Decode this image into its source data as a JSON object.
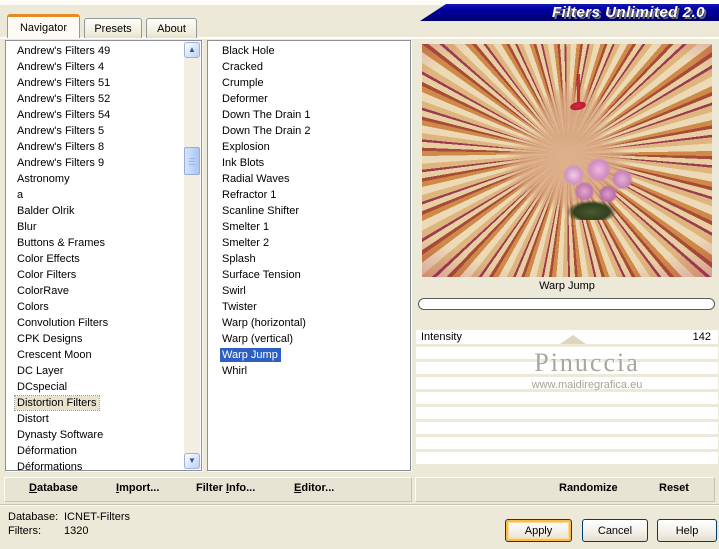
{
  "window": {
    "banner_title": "Filters Unlimited 2.0"
  },
  "tabs": [
    {
      "label": "Navigator",
      "active": true
    },
    {
      "label": "Presets",
      "active": false
    },
    {
      "label": "About",
      "active": false
    }
  ],
  "category_list": {
    "items": [
      "Andrew's Filters 49",
      "Andrew's Filters 4",
      "Andrew's Filters 51",
      "Andrew's Filters 52",
      "Andrew's Filters 54",
      "Andrew's Filters 5",
      "Andrew's Filters 8",
      "Andrew's Filters 9",
      "Astronomy",
      "a",
      "Balder Olrik",
      "Blur",
      "Buttons & Frames",
      "Color Effects",
      "Color Filters",
      "ColorRave",
      "Colors",
      "Convolution Filters",
      "CPK Designs",
      "Crescent Moon",
      "DC Layer",
      "DCspecial",
      "Distortion Filters",
      "Distort",
      "Dynasty Software",
      "Déformation",
      "Déformations"
    ],
    "selected": "Distortion Filters"
  },
  "filter_list": {
    "items": [
      "Black Hole",
      "Cracked",
      "Crumple",
      "Deformer",
      "Down The Drain 1",
      "Down The Drain 2",
      "Explosion",
      "Ink Blots",
      "Radial Waves",
      "Refractor 1",
      "Scanline Shifter",
      "Smelter 1",
      "Smelter 2",
      "Splash",
      "Surface Tension",
      "Swirl",
      "Twister",
      "Warp (horizontal)",
      "Warp (vertical)",
      "Warp Jump",
      "Whirl"
    ],
    "selected": "Warp Jump"
  },
  "preview": {
    "caption": "Warp Jump",
    "progress_percent": 0,
    "watermark_name": "Pinuccia",
    "watermark_url": "www.maidiregrafica.eu"
  },
  "controls": {
    "sliders": [
      {
        "label": "Intensity",
        "value": "142"
      }
    ]
  },
  "left_toolbar": {
    "items": [
      {
        "pre": "",
        "key": "D",
        "post": "atabase"
      },
      {
        "pre": "",
        "key": "I",
        "post": "mport..."
      },
      {
        "pre": "Filter ",
        "key": "I",
        "post": "nfo..."
      },
      {
        "pre": "",
        "key": "E",
        "post": "ditor..."
      }
    ]
  },
  "right_toolbar": {
    "randomize_label": "Randomize",
    "reset_label": "Reset"
  },
  "status": {
    "database_label": "Database:",
    "database_value": "ICNET-Filters",
    "filters_label": "Filters:",
    "filters_value": "1320"
  },
  "action_buttons": {
    "apply": "Apply",
    "cancel": "Cancel",
    "help": "Help"
  },
  "icons": {
    "scroll_up": "▲",
    "scroll_down": "▼"
  },
  "colors": {
    "dialog_bg": "#ece9d8",
    "banner_navy": "#0000a0",
    "selection_blue": "#2e5fc3",
    "active_tab_orange": "#e78a23",
    "magenta_preview": "#9e1851"
  }
}
